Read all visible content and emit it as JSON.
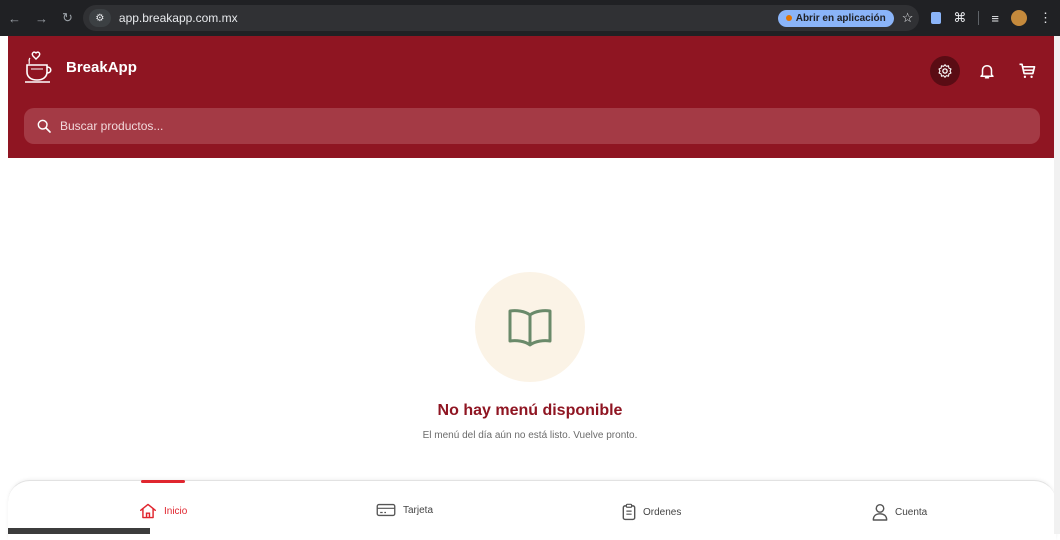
{
  "browser": {
    "url": "app.breakapp.com.mx",
    "open_in_app_label": "Abrir en aplicación"
  },
  "header": {
    "brand": "BreakApp",
    "search_placeholder": "Buscar productos..."
  },
  "empty_state": {
    "title": "No hay menú disponible",
    "subtitle": "El menú del día aún no está listo. Vuelve pronto."
  },
  "bottom_nav": {
    "items": [
      {
        "label": "Inicio",
        "icon": "home-icon",
        "active": true
      },
      {
        "label": "Tarjeta",
        "icon": "card-icon",
        "active": false
      },
      {
        "label": "Ordenes",
        "icon": "clipboard-icon",
        "active": false
      },
      {
        "label": "Cuenta",
        "icon": "user-icon",
        "active": false
      }
    ]
  },
  "colors": {
    "brand": "#8f1522",
    "active": "#e0262f",
    "empty_icon_bg": "#fbf3e6",
    "empty_icon": "#6a8a6a"
  }
}
